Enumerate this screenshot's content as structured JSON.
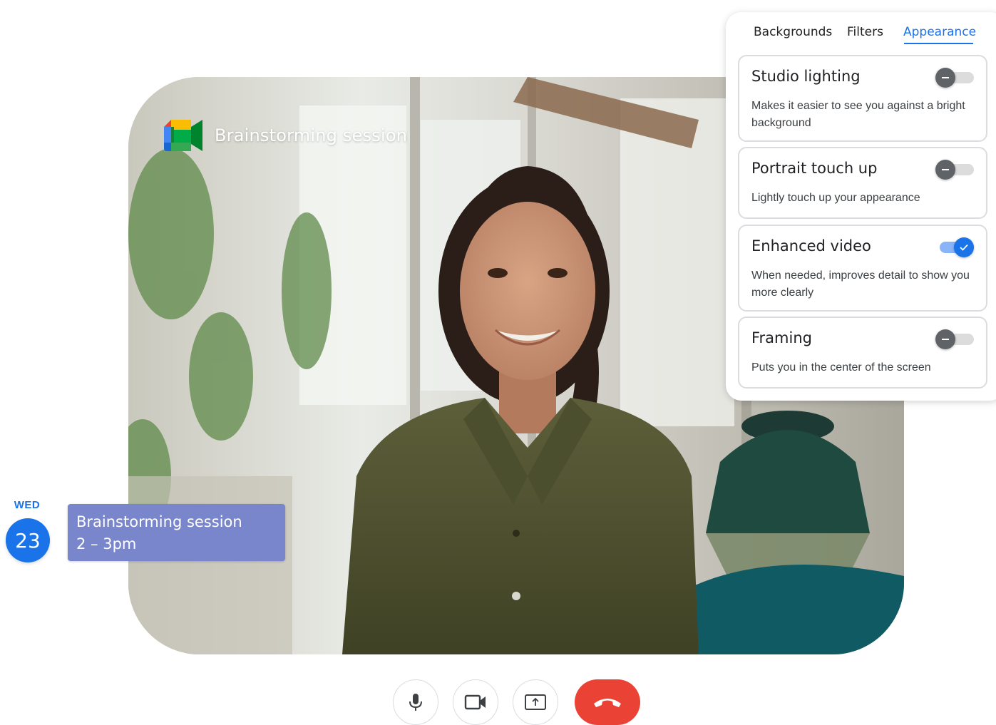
{
  "meeting": {
    "title": "Brainstorming session"
  },
  "calendar": {
    "weekday": "WED",
    "date": "23",
    "event_title": "Brainstorming session",
    "event_time": "2 – 3pm",
    "event_color": "#7986cb"
  },
  "effects_panel": {
    "tabs": [
      {
        "label": "Backgrounds",
        "active": false
      },
      {
        "label": "Filters",
        "active": false
      },
      {
        "label": "Appearance",
        "active": true
      }
    ],
    "options": [
      {
        "title": "Studio lighting",
        "description": "Makes it easier to see you against a bright background",
        "enabled": false
      },
      {
        "title": "Portrait touch up",
        "description": "Lightly touch up your appearance",
        "enabled": false
      },
      {
        "title": "Enhanced video",
        "description": "When needed, improves detail to show you more clearly",
        "enabled": true
      },
      {
        "title": "Framing",
        "description": "Puts you in the center of the screen",
        "enabled": false
      }
    ]
  },
  "controls": {
    "buttons": [
      "microphone-icon",
      "camera-icon",
      "present-screen-icon",
      "hang-up-icon"
    ],
    "hangup_color": "#ea4335"
  },
  "colors": {
    "accent": "#1a73e8",
    "toggle_off": "#5f6368"
  }
}
